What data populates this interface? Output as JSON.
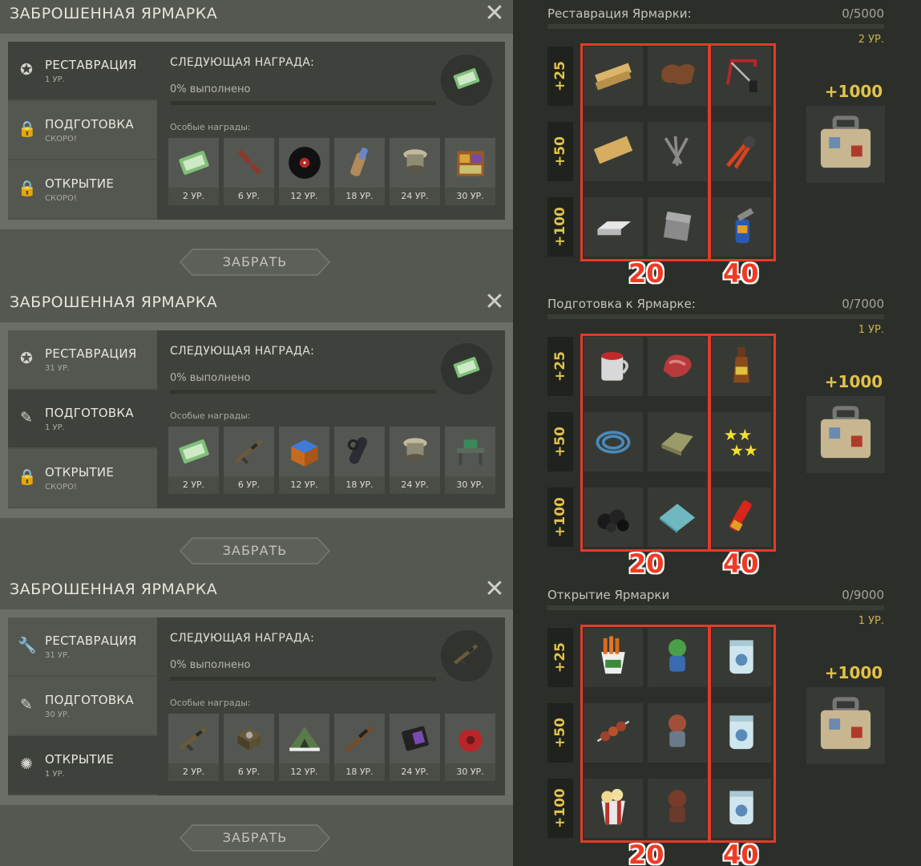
{
  "left_panels": [
    {
      "title": "ЗАБРОШЕННАЯ ЯРМАРКА",
      "tabs": [
        {
          "name": "РЕСТАВРАЦИЯ",
          "sub": "1 УР.",
          "icon": "medal-icon",
          "glyph": "✪",
          "active": true
        },
        {
          "name": "ПОДГОТОВКА",
          "sub": "СКОРО!",
          "icon": "lock-icon",
          "glyph": "🔒",
          "active": false
        },
        {
          "name": "ОТКРЫТИЕ",
          "sub": "СКОРО!",
          "icon": "lock-icon",
          "glyph": "🔒",
          "active": false
        }
      ],
      "next_reward_label": "СЛЕДУЮЩАЯ НАГРАДА:",
      "progress_text": "0% выполнено",
      "progress": 0,
      "special_label": "Особые награды:",
      "reward_icon": "ticket-icon",
      "slots": [
        {
          "level": "2 УР.",
          "icon": "ticket-icon"
        },
        {
          "level": "6 УР.",
          "icon": "crossbow-icon"
        },
        {
          "level": "12 УР.",
          "icon": "vinyl-record-icon"
        },
        {
          "level": "18 УР.",
          "icon": "quiver-icon"
        },
        {
          "level": "24 УР.",
          "icon": "spotlight-icon"
        },
        {
          "level": "30 УР.",
          "icon": "cabinet-icon"
        }
      ],
      "claim_label": "ЗАБРАТЬ"
    },
    {
      "title": "ЗАБРОШЕННАЯ ЯРМАРКА",
      "tabs": [
        {
          "name": "РЕСТАВРАЦИЯ",
          "sub": "31 УР.",
          "icon": "medal-icon",
          "glyph": "✪",
          "active": false
        },
        {
          "name": "ПОДГОТОВКА",
          "sub": "1 УР.",
          "icon": "brush-icon",
          "glyph": "✎",
          "active": true
        },
        {
          "name": "ОТКРЫТИЕ",
          "sub": "СКОРО!",
          "icon": "lock-icon",
          "glyph": "🔒",
          "active": false
        }
      ],
      "next_reward_label": "СЛЕДУЮЩАЯ НАГРАДА:",
      "progress_text": "0% выполнено",
      "progress": 0,
      "special_label": "Особые награды:",
      "reward_icon": "ticket-icon",
      "slots": [
        {
          "level": "2 УР.",
          "icon": "ticket-icon"
        },
        {
          "level": "6 УР.",
          "icon": "rifle-icon"
        },
        {
          "level": "12 УР.",
          "icon": "crate-icon"
        },
        {
          "level": "18 УР.",
          "icon": "silencer-icon"
        },
        {
          "level": "24 УР.",
          "icon": "spotlight-icon"
        },
        {
          "level": "30 УР.",
          "icon": "workbench-icon"
        }
      ],
      "claim_label": "ЗАБРАТЬ"
    },
    {
      "title": "ЗАБРОШЕННАЯ ЯРМАРКА",
      "tabs": [
        {
          "name": "РЕСТАВРАЦИЯ",
          "sub": "31 УР.",
          "icon": "wrench-icon",
          "glyph": "🔧",
          "active": false
        },
        {
          "name": "ПОДГОТОВКА",
          "sub": "30 УР.",
          "icon": "brush-icon",
          "glyph": "✎",
          "active": false
        },
        {
          "name": "ОТКРЫТИЕ",
          "sub": "1 УР.",
          "icon": "party-popper-icon",
          "glyph": "✺",
          "active": true
        }
      ],
      "next_reward_label": "СЛЕДУЮЩАЯ НАГРАДА:",
      "progress_text": "0% выполнено",
      "progress": 0,
      "special_label": "Особые награды:",
      "reward_icon": "rifle-icon",
      "slots": [
        {
          "level": "2 УР.",
          "icon": "rifle-icon"
        },
        {
          "level": "6 УР.",
          "icon": "generator-icon"
        },
        {
          "level": "12 УР.",
          "icon": "tent-icon"
        },
        {
          "level": "18 УР.",
          "icon": "sniper-rifle-icon"
        },
        {
          "level": "24 УР.",
          "icon": "badge-wallet-icon"
        },
        {
          "level": "30 УР.",
          "icon": "gas-tank-icon"
        }
      ],
      "claim_label": "ЗАБРАТЬ"
    }
  ],
  "right_sections": [
    {
      "title": "Реставрация Ярмарки:",
      "count": "0/5000",
      "level": "2 УР.",
      "rows": [
        "+25",
        "+50",
        "+100"
      ],
      "grid": [
        [
          "planks-icon",
          "leather-icon",
          "hacksaw-icon"
        ],
        [
          "board-icon",
          "nails-icon",
          "pliers-icon"
        ],
        [
          "metal-ingot-icon",
          "metal-sheet-icon",
          "blowtorch-icon"
        ]
      ],
      "box20_label": "20",
      "box40_label": "40",
      "bonus_label": "+1000",
      "bonus_icon": "suitcase-icon"
    },
    {
      "title": "Подготовка к Ярмарке:",
      "count": "0/7000",
      "level": "1 УР.",
      "rows": [
        "+25",
        "+50",
        "+100"
      ],
      "grid": [
        [
          "paint-mug-icon",
          "meat-icon",
          "bottle-icon"
        ],
        [
          "cable-icon",
          "cloth-icon",
          "stars-icon"
        ],
        [
          "coal-icon",
          "glass-icon",
          "flare-icon"
        ]
      ],
      "box20_label": "20",
      "box40_label": "40",
      "bonus_label": "+1000",
      "bonus_icon": "suitcase-icon"
    },
    {
      "title": "Открытие Ярмарки",
      "count": "0/9000",
      "level": "1 УР.",
      "rows": [
        "+25",
        "+50",
        "+100"
      ],
      "grid": [
        [
          "fries-icon",
          "zombie-toy-icon",
          "jar-icon"
        ],
        [
          "kebab-icon",
          "zombie-doll-icon",
          "jar-icon"
        ],
        [
          "popcorn-icon",
          "zombie-plush-icon",
          "jar-icon"
        ]
      ],
      "box20_label": "20",
      "box40_label": "40",
      "bonus_label": "+1000",
      "bonus_icon": "suitcase-icon"
    }
  ]
}
